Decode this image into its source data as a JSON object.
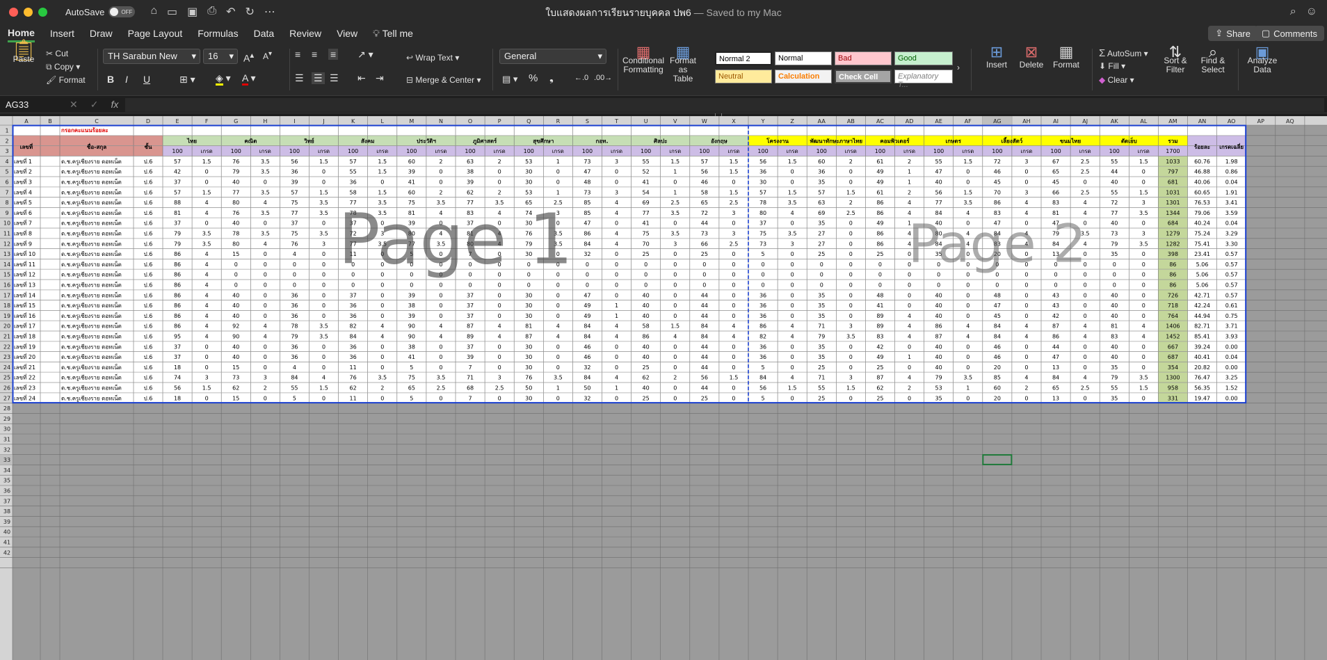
{
  "window": {
    "autosave_label": "AutoSave",
    "autosave_state": "OFF",
    "doc_title": "ใบแสดงผลการเรียนรายบุคคล ปพ6",
    "saved_status": "— Saved to my Mac"
  },
  "menu": {
    "tabs": [
      "Home",
      "Insert",
      "Draw",
      "Page Layout",
      "Formulas",
      "Data",
      "Review",
      "View"
    ],
    "tell_me": "Tell me",
    "share": "Share",
    "comments": "Comments"
  },
  "ribbon": {
    "paste": "Paste",
    "cut": "Cut",
    "copy": "Copy",
    "format_painter": "Format",
    "font_name": "TH Sarabun New",
    "font_size": "16",
    "bold": "B",
    "italic": "I",
    "underline": "U",
    "wrap_text": "Wrap Text",
    "merge_center": "Merge & Center",
    "number_format": "General",
    "conditional_formatting": "Conditional Formatting",
    "format_as_table": "Format as Table",
    "styles": {
      "normal2": "Normal 2",
      "normal": "Normal",
      "bad": "Bad",
      "good": "Good",
      "neutral": "Neutral",
      "calculation": "Calculation",
      "check_cell": "Check Cell",
      "explanatory": "Explanatory T..."
    },
    "insert": "Insert",
    "delete": "Delete",
    "format": "Format",
    "autosum": "AutoSum",
    "fill": "Fill",
    "clear": "Clear",
    "sort_filter": "Sort & Filter",
    "find_select": "Find & Select",
    "analyze_data": "Analyze Data"
  },
  "formula_bar": {
    "name_box": "AG33",
    "fx": "fx",
    "content": ""
  },
  "sheet": {
    "columns": [
      "A",
      "B",
      "C",
      "D",
      "E",
      "F",
      "G",
      "H",
      "I",
      "J",
      "K",
      "L",
      "M",
      "N",
      "O",
      "P",
      "Q",
      "R",
      "S",
      "T",
      "U",
      "V",
      "W",
      "X",
      "Y",
      "Z",
      "AA",
      "AB",
      "AC",
      "AD",
      "AE",
      "AF",
      "AG",
      "AH",
      "AI",
      "AJ",
      "AK",
      "AL",
      "AM",
      "AN",
      "AO",
      "AP",
      "AQ"
    ],
    "col_widths": [
      52,
      26,
      108,
      42,
      42,
      42,
      42,
      42,
      42,
      42,
      42,
      42,
      42,
      42,
      42,
      42,
      42,
      42,
      42,
      42,
      42,
      42,
      42,
      42,
      42,
      42,
      42,
      42,
      42,
      42,
      42,
      42,
      42,
      42,
      42,
      42,
      42,
      42,
      42,
      42,
      42,
      42,
      42
    ],
    "selected_cell": "AG33",
    "page_labels": [
      "Page 1",
      "Page 2"
    ],
    "note": "กรอกคะแนนร้อยละ",
    "header_student": "เลขที่",
    "header_name": "ชื่อ-สกุล",
    "header_class": "ชั้น",
    "subjects": [
      "ไทย",
      "คณิต",
      "วิทย์",
      "สังคม",
      "ประวัติฯ",
      "ภูมิศาสตร์",
      "สุขศึกษา",
      "กอท.",
      "ศิลปะ",
      "อังกฤษ"
    ],
    "subjects_extra": [
      "โครงงาน",
      "พัฒนาทักษะภาษาไทย",
      "คอมพิวเตอร์",
      "เกษตร",
      "เลี้ยงสัตว์",
      "ขนมไทย",
      "ตัดเย็บ"
    ],
    "sub_headers": [
      "100",
      "เกรด"
    ],
    "total_header": "รวม",
    "total_max": "1700",
    "percent_header": "ร้อยละ",
    "gpa_header": "เกรดเฉลี่ย",
    "students": [
      {
        "no": "เลขที่ 1",
        "name": "ด.ช.ครูเชียงราย ดอทเน็ต",
        "cls": "ป.6",
        "scores": [
          57,
          1.5,
          76,
          3.5,
          56,
          1.5,
          57,
          1.5,
          60,
          2,
          63,
          2,
          53,
          1,
          73,
          3,
          55,
          1.5,
          57,
          1.5,
          56,
          1.5,
          60,
          2,
          61,
          2,
          55,
          1.5,
          72,
          3,
          67,
          2.5,
          55,
          1.5
        ],
        "total": "1033",
        "pct": "60.76",
        "gpa": "1.98"
      },
      {
        "no": "เลขที่ 2",
        "name": "ด.ช.ครูเชียงราย ดอทเน็ต",
        "cls": "ป.6",
        "scores": [
          42,
          0,
          79,
          3.5,
          36,
          0,
          55,
          1.5,
          39,
          0,
          38,
          0,
          30,
          0,
          47,
          0,
          52,
          1,
          56,
          1.5,
          36,
          0,
          36,
          0,
          49,
          1,
          47,
          0,
          46,
          0,
          65,
          2.5,
          44,
          0
        ],
        "total": "797",
        "pct": "46.88",
        "gpa": "0.86"
      },
      {
        "no": "เลขที่ 3",
        "name": "ด.ช.ครูเชียงราย ดอทเน็ต",
        "cls": "ป.6",
        "scores": [
          37,
          0,
          40,
          0,
          39,
          0,
          36,
          0,
          41,
          0,
          39,
          0,
          30,
          0,
          48,
          0,
          41,
          0,
          46,
          0,
          30,
          0,
          35,
          0,
          49,
          1,
          40,
          0,
          45,
          0,
          45,
          0,
          40,
          0
        ],
        "total": "681",
        "pct": "40.06",
        "gpa": "0.04"
      },
      {
        "no": "เลขที่ 4",
        "name": "ด.ช.ครูเชียงราย ดอทเน็ต",
        "cls": "ป.6",
        "scores": [
          57,
          1.5,
          77,
          3.5,
          57,
          1.5,
          58,
          1.5,
          60,
          2,
          62,
          2,
          53,
          1,
          73,
          3,
          54,
          1,
          58,
          1.5,
          57,
          1.5,
          57,
          1.5,
          61,
          2,
          56,
          1.5,
          70,
          3,
          66,
          2.5,
          55,
          1.5
        ],
        "total": "1031",
        "pct": "60.65",
        "gpa": "1.91"
      },
      {
        "no": "เลขที่ 5",
        "name": "ด.ช.ครูเชียงราย ดอทเน็ต",
        "cls": "ป.6",
        "scores": [
          88,
          4,
          80,
          4,
          75,
          3.5,
          77,
          3.5,
          75,
          3.5,
          77,
          3.5,
          65,
          2.5,
          85,
          4,
          69,
          2.5,
          65,
          2.5,
          78,
          3.5,
          63,
          2,
          86,
          4,
          77,
          3.5,
          86,
          4,
          83,
          4,
          72,
          3
        ],
        "total": "1301",
        "pct": "76.53",
        "gpa": "3.41"
      },
      {
        "no": "เลขที่ 6",
        "name": "ด.ช.ครูเชียงราย ดอทเน็ต",
        "cls": "ป.6",
        "scores": [
          81,
          4,
          76,
          3.5,
          77,
          3.5,
          78,
          3.5,
          81,
          4,
          83,
          4,
          74,
          3,
          85,
          4,
          77,
          3.5,
          72,
          3,
          80,
          4,
          69,
          2.5,
          86,
          4,
          84,
          4,
          83,
          4,
          81,
          4,
          77,
          3.5
        ],
        "total": "1344",
        "pct": "79.06",
        "gpa": "3.59"
      },
      {
        "no": "เลขที่ 7",
        "name": "ด.ช.ครูเชียงราย ดอทเน็ต",
        "cls": "ป.6",
        "scores": [
          37,
          0,
          40,
          0,
          37,
          0,
          37,
          0,
          39,
          0,
          37,
          0,
          30,
          0,
          47,
          0,
          41,
          0,
          44,
          0,
          37,
          0,
          35,
          0,
          49,
          1,
          40,
          0,
          47,
          0,
          47,
          0,
          40,
          0
        ],
        "total": "684",
        "pct": "40.24",
        "gpa": "0.04"
      },
      {
        "no": "เลขที่ 8",
        "name": "ด.ช.ครูเชียงราย ดอทเน็ต",
        "cls": "ป.6",
        "scores": [
          79,
          3.5,
          78,
          3.5,
          75,
          3.5,
          72,
          3,
          80,
          4,
          81,
          4,
          76,
          3.5,
          86,
          4,
          75,
          3.5,
          73,
          3,
          75,
          3.5,
          27,
          0,
          86,
          4,
          80,
          4,
          84,
          4,
          79,
          3.5,
          73,
          3
        ],
        "total": "1279",
        "pct": "75.24",
        "gpa": "3.29"
      },
      {
        "no": "เลขที่ 9",
        "name": "ด.ช.ครูเชียงราย ดอทเน็ต",
        "cls": "ป.6",
        "scores": [
          79,
          3.5,
          80,
          4,
          76,
          3,
          77,
          3.5,
          77,
          3.5,
          80,
          4,
          79,
          3.5,
          84,
          4,
          70,
          3,
          66,
          2.5,
          73,
          3,
          27,
          0,
          86,
          4,
          84,
          4,
          83,
          4,
          84,
          4,
          79,
          3.5
        ],
        "total": "1282",
        "pct": "75.41",
        "gpa": "3.30"
      },
      {
        "no": "เลขที่ 10",
        "name": "ด.ช.ครูเชียงราย ดอทเน็ต",
        "cls": "ป.6",
        "scores": [
          86,
          4,
          15,
          0,
          4,
          0,
          11,
          0,
          5,
          0,
          7,
          0,
          30,
          0,
          32,
          0,
          25,
          0,
          25,
          0,
          5,
          0,
          25,
          0,
          25,
          0,
          35,
          0,
          20,
          0,
          13,
          0,
          35,
          0
        ],
        "total": "398",
        "pct": "23.41",
        "gpa": "0.57"
      },
      {
        "no": "เลขที่ 11",
        "name": "ด.ช.ครูเชียงราย ดอทเน็ต",
        "cls": "ป.6",
        "scores": [
          86,
          4,
          0,
          0,
          0,
          0,
          0,
          0,
          0,
          0,
          0,
          0,
          0,
          0,
          0,
          0,
          0,
          0,
          0,
          0,
          0,
          0,
          0,
          0,
          0,
          0,
          0,
          0,
          0,
          0,
          0,
          0,
          0,
          0
        ],
        "total": "86",
        "pct": "5.06",
        "gpa": "0.57"
      },
      {
        "no": "เลขที่ 12",
        "name": "ด.ช.ครูเชียงราย ดอทเน็ต",
        "cls": "ป.6",
        "scores": [
          86,
          4,
          0,
          0,
          0,
          0,
          0,
          0,
          0,
          0,
          0,
          0,
          0,
          0,
          0,
          0,
          0,
          0,
          0,
          0,
          0,
          0,
          0,
          0,
          0,
          0,
          0,
          0,
          0,
          0,
          0,
          0,
          0,
          0
        ],
        "total": "86",
        "pct": "5.06",
        "gpa": "0.57"
      },
      {
        "no": "เลขที่ 13",
        "name": "ด.ช.ครูเชียงราย ดอทเน็ต",
        "cls": "ป.6",
        "scores": [
          86,
          4,
          0,
          0,
          0,
          0,
          0,
          0,
          0,
          0,
          0,
          0,
          0,
          0,
          0,
          0,
          0,
          0,
          0,
          0,
          0,
          0,
          0,
          0,
          0,
          0,
          0,
          0,
          0,
          0,
          0,
          0,
          0,
          0
        ],
        "total": "86",
        "pct": "5.06",
        "gpa": "0.57"
      },
      {
        "no": "เลขที่ 14",
        "name": "ด.ช.ครูเชียงราย ดอทเน็ต",
        "cls": "ป.6",
        "scores": [
          86,
          4,
          40,
          0,
          36,
          0,
          37,
          0,
          39,
          0,
          37,
          0,
          30,
          0,
          47,
          0,
          40,
          0,
          44,
          0,
          36,
          0,
          35,
          0,
          48,
          0,
          40,
          0,
          48,
          0,
          43,
          0,
          40,
          0
        ],
        "total": "726",
        "pct": "42.71",
        "gpa": "0.57"
      },
      {
        "no": "เลขที่ 15",
        "name": "ด.ช.ครูเชียงราย ดอทเน็ต",
        "cls": "ป.6",
        "scores": [
          86,
          4,
          40,
          0,
          36,
          0,
          36,
          0,
          38,
          0,
          37,
          0,
          30,
          0,
          49,
          1,
          40,
          0,
          44,
          0,
          36,
          0,
          35,
          0,
          41,
          0,
          40,
          0,
          47,
          0,
          43,
          0,
          40,
          0
        ],
        "total": "718",
        "pct": "42.24",
        "gpa": "0.61"
      },
      {
        "no": "เลขที่ 16",
        "name": "ด.ช.ครูเชียงราย ดอทเน็ต",
        "cls": "ป.6",
        "scores": [
          86,
          4,
          40,
          0,
          36,
          0,
          36,
          0,
          39,
          0,
          37,
          0,
          30,
          0,
          49,
          1,
          40,
          0,
          44,
          0,
          36,
          0,
          35,
          0,
          89,
          4,
          40,
          0,
          45,
          0,
          42,
          0,
          40,
          0
        ],
        "total": "764",
        "pct": "44.94",
        "gpa": "0.75"
      },
      {
        "no": "เลขที่ 17",
        "name": "ด.ช.ครูเชียงราย ดอทเน็ต",
        "cls": "ป.6",
        "scores": [
          86,
          4,
          92,
          4,
          78,
          3.5,
          82,
          4,
          90,
          4,
          87,
          4,
          81,
          4,
          84,
          4,
          58,
          1.5,
          84,
          4,
          86,
          4,
          71,
          3,
          89,
          4,
          86,
          4,
          84,
          4,
          87,
          4,
          81,
          4
        ],
        "total": "1406",
        "pct": "82.71",
        "gpa": "3.71"
      },
      {
        "no": "เลขที่ 18",
        "name": "ด.ช.ครูเชียงราย ดอทเน็ต",
        "cls": "ป.6",
        "scores": [
          95,
          4,
          90,
          4,
          79,
          3.5,
          84,
          4,
          90,
          4,
          89,
          4,
          87,
          4,
          84,
          4,
          86,
          4,
          84,
          4,
          82,
          4,
          79,
          3.5,
          83,
          4,
          87,
          4,
          84,
          4,
          86,
          4,
          83,
          4
        ],
        "total": "1452",
        "pct": "85.41",
        "gpa": "3.93"
      },
      {
        "no": "เลขที่ 19",
        "name": "ด.ช.ครูเชียงราย ดอทเน็ต",
        "cls": "ป.6",
        "scores": [
          37,
          0,
          40,
          0,
          36,
          0,
          36,
          0,
          38,
          0,
          37,
          0,
          30,
          0,
          46,
          0,
          40,
          0,
          44,
          0,
          36,
          0,
          35,
          0,
          42,
          0,
          40,
          0,
          46,
          0,
          44,
          0,
          40,
          0
        ],
        "total": "667",
        "pct": "39.24",
        "gpa": "0.00"
      },
      {
        "no": "เลขที่ 20",
        "name": "ด.ช.ครูเชียงราย ดอทเน็ต",
        "cls": "ป.6",
        "scores": [
          37,
          0,
          40,
          0,
          36,
          0,
          36,
          0,
          41,
          0,
          39,
          0,
          30,
          0,
          46,
          0,
          40,
          0,
          44,
          0,
          36,
          0,
          35,
          0,
          49,
          1,
          40,
          0,
          46,
          0,
          47,
          0,
          40,
          0
        ],
        "total": "687",
        "pct": "40.41",
        "gpa": "0.04"
      },
      {
        "no": "เลขที่ 21",
        "name": "ด.ช.ครูเชียงราย ดอทเน็ต",
        "cls": "ป.6",
        "scores": [
          18,
          0,
          15,
          0,
          4,
          0,
          11,
          0,
          5,
          0,
          7,
          0,
          30,
          0,
          32,
          0,
          25,
          0,
          44,
          0,
          5,
          0,
          25,
          0,
          25,
          0,
          40,
          0,
          20,
          0,
          13,
          0,
          35,
          0
        ],
        "total": "354",
        "pct": "20.82",
        "gpa": "0.00"
      },
      {
        "no": "เลขที่ 22",
        "name": "ด.ช.ครูเชียงราย ดอทเน็ต",
        "cls": "ป.6",
        "scores": [
          74,
          3,
          73,
          3,
          84,
          4,
          76,
          3.5,
          75,
          3.5,
          71,
          3,
          76,
          3.5,
          84,
          4,
          62,
          2,
          56,
          1.5,
          84,
          4,
          71,
          3,
          87,
          4,
          79,
          3.5,
          85,
          4,
          84,
          4,
          79,
          3.5
        ],
        "total": "1300",
        "pct": "76.47",
        "gpa": "3.25"
      },
      {
        "no": "เลขที่ 23",
        "name": "ด.ช.ครูเชียงราย ดอทเน็ต",
        "cls": "ป.6",
        "scores": [
          56,
          1.5,
          62,
          2,
          55,
          1.5,
          62,
          2,
          65,
          2.5,
          68,
          2.5,
          50,
          1,
          50,
          1,
          40,
          0,
          44,
          0,
          56,
          1.5,
          55,
          1.5,
          62,
          2,
          53,
          1,
          60,
          2,
          65,
          2.5,
          55,
          1.5
        ],
        "total": "958",
        "pct": "56.35",
        "gpa": "1.52"
      },
      {
        "no": "เลขที่ 24",
        "name": "ด.ช.ครูเชียงราย ดอทเน็ต",
        "cls": "ป.6",
        "scores": [
          18,
          0,
          15,
          0,
          5,
          0,
          11,
          0,
          5,
          0,
          7,
          0,
          30,
          0,
          32,
          0,
          25,
          0,
          25,
          0,
          5,
          0,
          25,
          0,
          25,
          0,
          35,
          0,
          20,
          0,
          13,
          0,
          35,
          0
        ],
        "total": "331",
        "pct": "19.47",
        "gpa": "0.00"
      }
    ],
    "colors": {
      "header_green": "#c6deb5",
      "header_yellow": "#ffff00",
      "name_header": "#d9958f",
      "sub_purple": "#cdbde6",
      "total_green": "#c4d79b",
      "note_red": "#e00000",
      "page_border": "#1a3fd0",
      "outside_gray": "#9b9b9b"
    }
  }
}
